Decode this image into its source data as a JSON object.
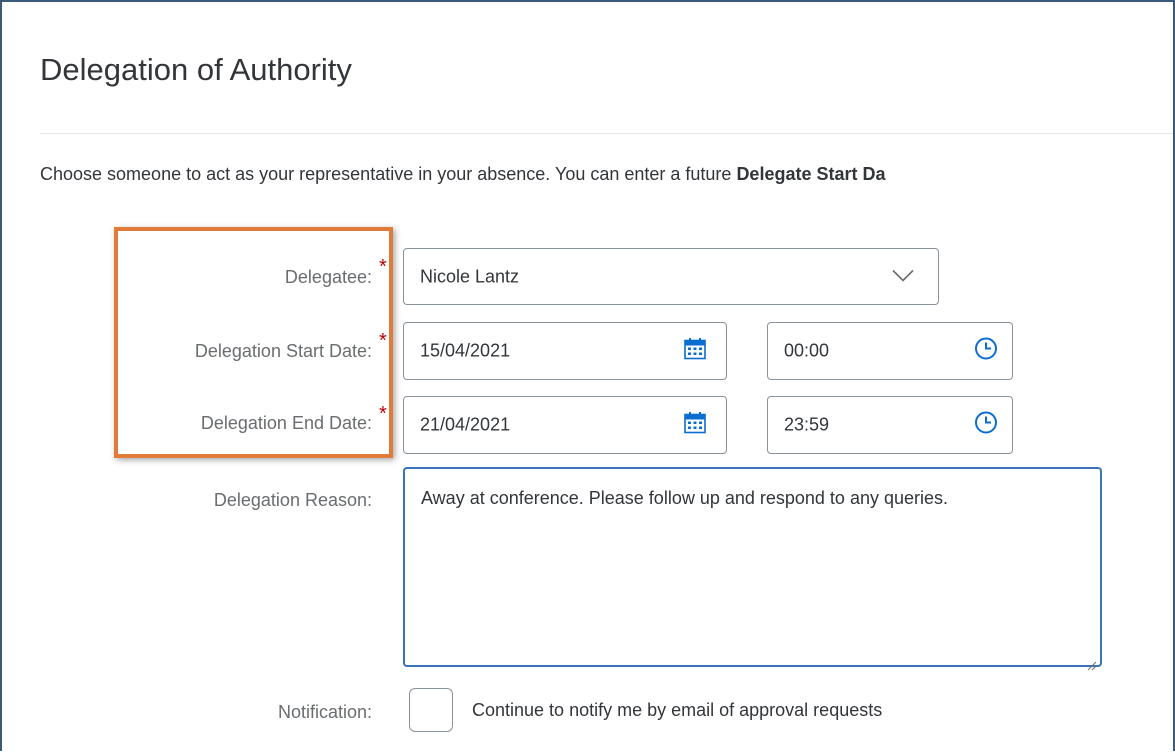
{
  "page": {
    "title": "Delegation of Authority",
    "intro_text": "Choose someone to act as your representative in your absence. You can enter a future ",
    "intro_bold": "Delegate Start Da"
  },
  "form": {
    "delegatee": {
      "label": "Delegatee:",
      "required": "*",
      "value": "Nicole Lantz"
    },
    "start": {
      "label": "Delegation Start Date:",
      "required": "*",
      "date": "15/04/2021",
      "time": "00:00"
    },
    "end": {
      "label": "Delegation End Date:",
      "required": "*",
      "date": "21/04/2021",
      "time": "23:59"
    },
    "reason": {
      "label": "Delegation Reason:",
      "value": "Away at conference. Please follow up and respond to any queries."
    },
    "notification": {
      "label": "Notification:",
      "checkbox_label": "Continue to notify me by email of approval requests",
      "checked": false
    }
  },
  "colors": {
    "highlight": "#e07b39",
    "required": "#bb0000",
    "focus_border": "#3b73b9",
    "icon_blue": "#0a6ed1"
  }
}
